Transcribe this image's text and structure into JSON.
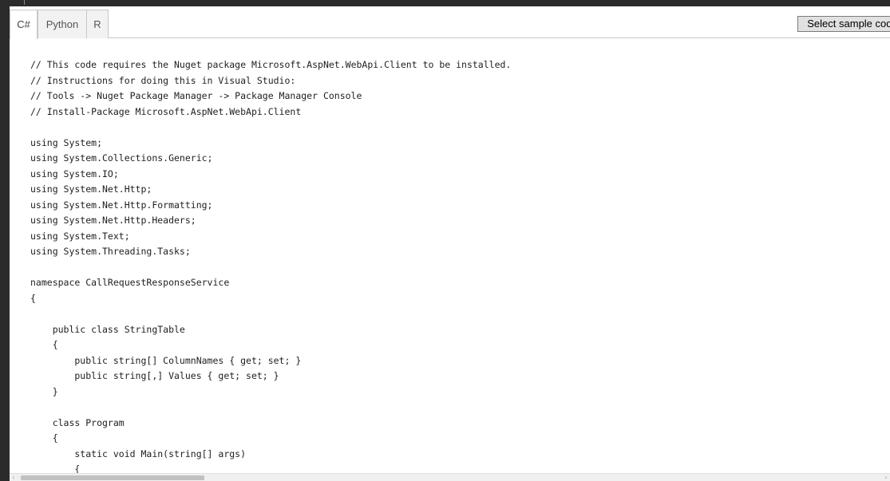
{
  "tabs": [
    {
      "label": "C#",
      "active": true
    },
    {
      "label": "Python",
      "active": false
    },
    {
      "label": "R",
      "active": false
    }
  ],
  "select_button_label": "Select sample code",
  "code_lines": [
    "// This code requires the Nuget package Microsoft.AspNet.WebApi.Client to be installed.",
    "// Instructions for doing this in Visual Studio:",
    "// Tools -> Nuget Package Manager -> Package Manager Console",
    "// Install-Package Microsoft.AspNet.WebApi.Client",
    "",
    "using System;",
    "using System.Collections.Generic;",
    "using System.IO;",
    "using System.Net.Http;",
    "using System.Net.Http.Formatting;",
    "using System.Net.Http.Headers;",
    "using System.Text;",
    "using System.Threading.Tasks;",
    "",
    "namespace CallRequestResponseService",
    "{",
    "",
    "    public class StringTable",
    "    {",
    "        public string[] ColumnNames { get; set; }",
    "        public string[,] Values { get; set; }",
    "    }",
    "",
    "    class Program",
    "    {",
    "        static void Main(string[] args)",
    "        {"
  ],
  "scrollbar": {
    "left_arrow": "‹",
    "right_arrow": "›"
  }
}
